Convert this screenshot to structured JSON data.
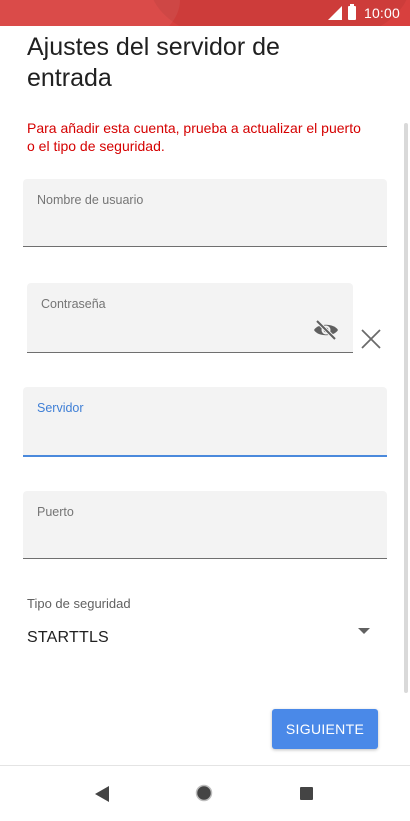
{
  "status_bar": {
    "time": "10:00",
    "icons": [
      "signal-icon",
      "battery-icon"
    ]
  },
  "page": {
    "title": "Ajustes del servidor de entrada",
    "error_message": "Para añadir esta cuenta, prueba a actualizar el puerto o el tipo de seguridad."
  },
  "fields": {
    "username": {
      "label": "Nombre de usuario",
      "value": ""
    },
    "password": {
      "label": "Contraseña",
      "value": ""
    },
    "server": {
      "label": "Servidor",
      "value": ""
    },
    "port": {
      "label": "Puerto",
      "value": ""
    }
  },
  "security": {
    "label": "Tipo de seguridad",
    "value": "STARTTLS"
  },
  "actions": {
    "next_label": "SIGUIENTE"
  },
  "colors": {
    "status_bar": "#d8403e",
    "accent": "#4a89e8",
    "error": "#d50000"
  },
  "nav_bar": {
    "icons": [
      "back-icon",
      "home-icon",
      "recents-icon"
    ]
  }
}
